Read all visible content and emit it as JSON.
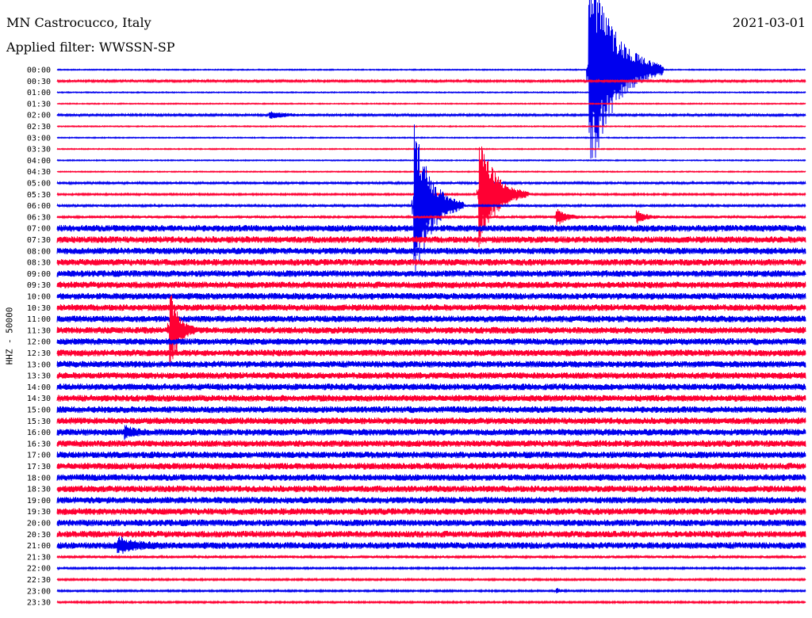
{
  "header": {
    "title": "MN Castrocucco, Italy",
    "date": "2021-03-01",
    "filter": "Applied filter: WWSSN-SP"
  },
  "ylabel": "HHZ - 50000",
  "colors": {
    "trace_a": "#0000ee",
    "trace_b": "#ff0033"
  },
  "chart_data": {
    "type": "line",
    "title": "MN Castrocucco, Italy",
    "ylabel": "HHZ - 50000",
    "trace_times": [
      "00:00",
      "00:30",
      "01:00",
      "01:30",
      "02:00",
      "02:30",
      "03:00",
      "03:30",
      "04:00",
      "04:30",
      "05:00",
      "05:30",
      "06:00",
      "06:30",
      "07:00",
      "07:30",
      "08:00",
      "08:30",
      "09:00",
      "09:30",
      "10:00",
      "10:30",
      "11:00",
      "11:30",
      "12:00",
      "12:30",
      "13:00",
      "13:30",
      "14:00",
      "14:30",
      "15:00",
      "15:30",
      "16:00",
      "16:30",
      "17:00",
      "17:30",
      "18:00",
      "18:30",
      "19:00",
      "19:30",
      "20:00",
      "20:30",
      "21:00",
      "21:30",
      "22:00",
      "22:30",
      "23:00",
      "23:30"
    ],
    "noise_level": [
      0.6,
      1.2,
      0.6,
      0.6,
      1.2,
      0.6,
      0.6,
      0.6,
      0.6,
      0.6,
      1.4,
      1.0,
      1.4,
      1.6,
      4.2,
      4.2,
      4.2,
      4.2,
      4.2,
      4.2,
      4.2,
      4.2,
      4.2,
      4.2,
      4.2,
      4.2,
      4.2,
      4.2,
      4.2,
      4.2,
      4.2,
      4.2,
      4.2,
      4.2,
      4.2,
      4.2,
      4.2,
      4.2,
      4.2,
      4.2,
      4.2,
      4.2,
      4.2,
      1.6,
      1.0,
      1.0,
      1.0,
      1.0
    ],
    "events": [
      {
        "trace": "02:00",
        "minute": 8.5,
        "amplitude": 5,
        "duration_min": 2
      },
      {
        "trace": "00:00",
        "minute": 21.3,
        "amplitude": 160,
        "duration_min": 3
      },
      {
        "trace": "05:30",
        "minute": 16.9,
        "amplitude": 80,
        "duration_min": 2
      },
      {
        "trace": "06:00",
        "minute": 14.3,
        "amplitude": 110,
        "duration_min": 2
      },
      {
        "trace": "06:30",
        "minute": 20.0,
        "amplitude": 14,
        "duration_min": 1
      },
      {
        "trace": "06:30",
        "minute": 23.2,
        "amplitude": 10,
        "duration_min": 1
      },
      {
        "trace": "11:30",
        "minute": 4.5,
        "amplitude": 55,
        "duration_min": 1
      },
      {
        "trace": "16:00",
        "minute": 2.7,
        "amplitude": 8,
        "duration_min": 1
      },
      {
        "trace": "21:00",
        "minute": 2.4,
        "amplitude": 10,
        "duration_min": 2
      },
      {
        "trace": "23:00",
        "minute": 20.0,
        "amplitude": 4,
        "duration_min": 0.5
      }
    ]
  }
}
